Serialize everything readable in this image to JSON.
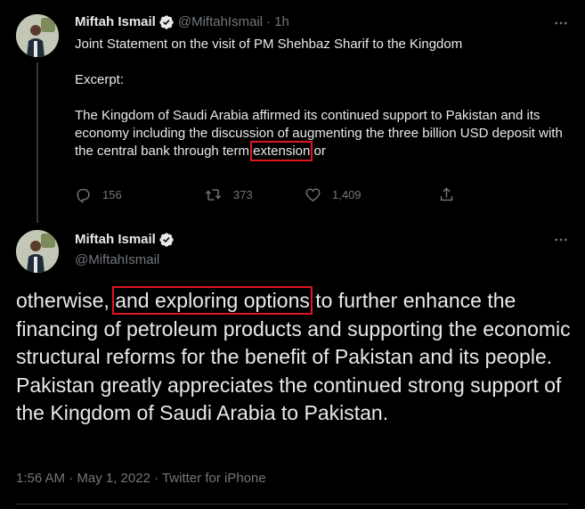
{
  "tweet1": {
    "display_name": "Miftah Ismail",
    "handle": "@MiftahIsmail",
    "separator": "·",
    "time": "1h",
    "line1": "Joint Statement on the visit of PM Shehbaz Sharif to the Kingdom",
    "line2": "Excerpt:",
    "para_before": "The Kingdom of Saudi Arabia affirmed its continued support to Pakistan and its economy including the discussion of augmenting the three billion USD deposit with the central bank through term ",
    "highlight": "extension",
    "para_after": " or",
    "reply_count": "156",
    "retweet_count": "373",
    "like_count": "1,409"
  },
  "tweet2": {
    "display_name": "Miftah Ismail",
    "handle": "@MiftahIsmail",
    "text_before": "otherwise, ",
    "highlight": "and exploring options",
    "text_after": " to further enhance the financing of petroleum products and supporting the economic structural reforms for the benefit of Pakistan and its people. Pakistan greatly appreciates the continued strong support of the Kingdom of Saudi Arabia to Pakistan.",
    "meta": "1:56 AM · May 1, 2022 · Twitter for iPhone"
  },
  "colors": {
    "background": "#000000",
    "text": "#e7e9ea",
    "secondary": "#71767b",
    "verified": "#1d9bf0",
    "highlight_box": "#e0161f"
  },
  "icons": [
    "verified-badge-icon",
    "more-icon",
    "reply-icon",
    "retweet-icon",
    "like-icon",
    "share-icon"
  ]
}
